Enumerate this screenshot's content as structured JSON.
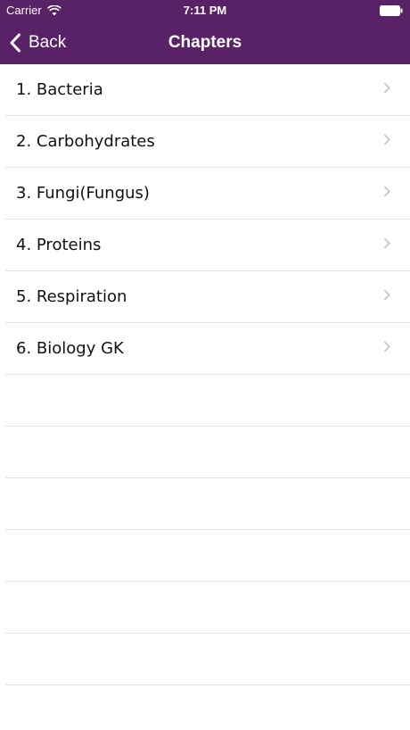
{
  "status_bar": {
    "carrier": "Carrier",
    "time": "7:11 PM"
  },
  "nav": {
    "back_label": "Back",
    "title": "Chapters"
  },
  "colors": {
    "header": "#5a2266",
    "separator": "#e3e3e3",
    "chevron": "#c7c7cc"
  },
  "chapters": [
    {
      "label": "1. Bacteria"
    },
    {
      "label": "2. Carbohydrates"
    },
    {
      "label": "3. Fungi(Fungus)"
    },
    {
      "label": "4. Proteins"
    },
    {
      "label": "5. Respiration"
    },
    {
      "label": "6. Biology GK"
    }
  ]
}
